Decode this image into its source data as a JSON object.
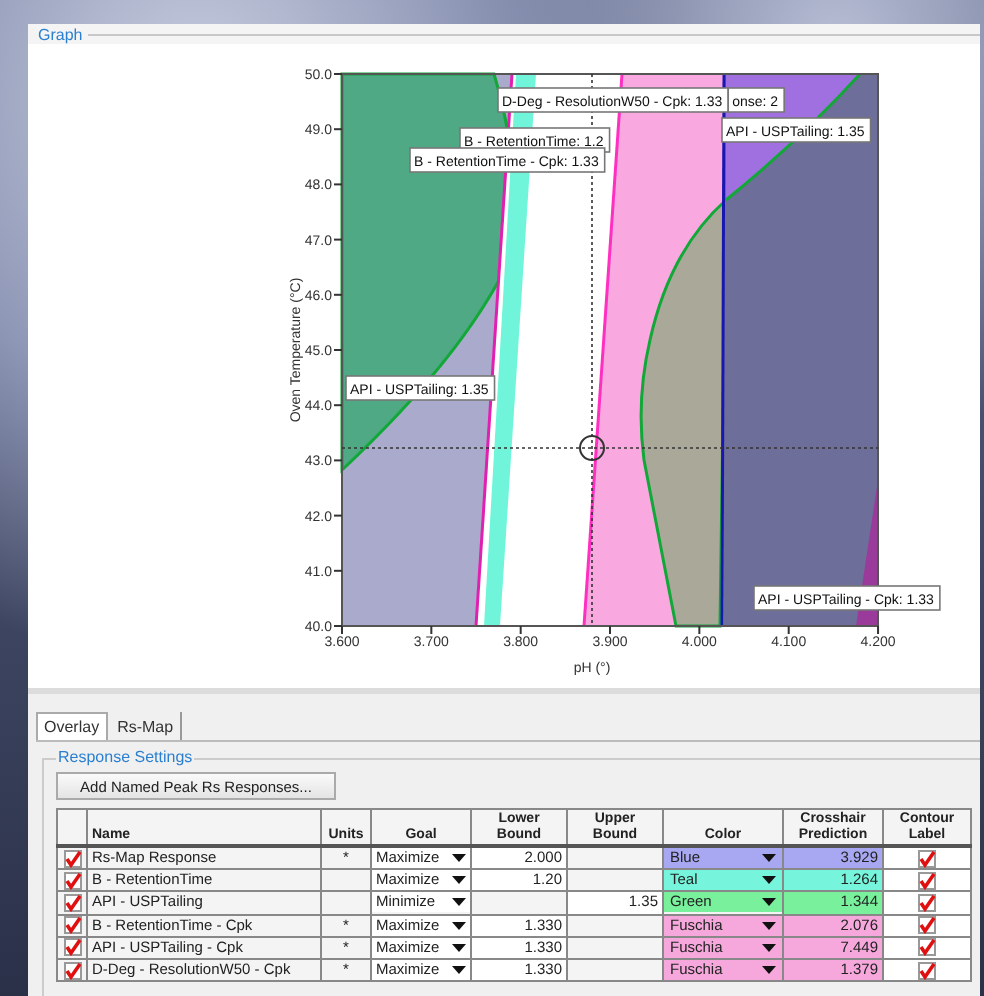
{
  "graph": {
    "title": "Graph",
    "xlabel": "pH (°)",
    "ylabel": "Oven Temperature (°C)",
    "xticks": [
      "3.600",
      "3.700",
      "3.800",
      "3.900",
      "4.000",
      "4.100",
      "4.200"
    ],
    "yticks": [
      "50.0",
      "49.0",
      "48.0",
      "47.0",
      "46.0",
      "45.0",
      "44.0",
      "43.0",
      "42.0",
      "41.0",
      "40.0"
    ],
    "contour_labels": [
      "D-Deg - ResolutionW50 - Cpk: 1.33",
      "onse: 2",
      "API - USPTailing: 1.35",
      "B - RetentionTime: 1.2",
      "B - RetentionTime - Cpk: 1.33",
      "API - USPTailing: 1.35",
      "API - USPTailing - Cpk: 1.33"
    ]
  },
  "tabs": [
    {
      "label": "Overlay",
      "selected": true
    },
    {
      "label": "Rs-Map",
      "selected": false
    }
  ],
  "response_settings": {
    "title": "Response Settings",
    "button": "Add Named Peak Rs Responses...",
    "columns": [
      "Name",
      "Units",
      "Goal",
      "Lower Bound",
      "Upper Bound",
      "Color",
      "Crosshair Prediction",
      "Contour Label"
    ],
    "rows": [
      {
        "checked": true,
        "name": "Rs-Map Response",
        "units": "*",
        "goal": "Maximize",
        "lower": "2.000",
        "color_name": "Blue",
        "color": "#a8a8f2",
        "prediction": "3.929",
        "contour_label": true
      },
      {
        "checked": true,
        "name": "B - RetentionTime",
        "goal": "Maximize",
        "lower": "1.20",
        "color_name": "Teal",
        "color": "#76f4dc",
        "prediction": "1.264",
        "contour_label": true
      },
      {
        "checked": true,
        "name": "API - USPTailing",
        "goal": "Minimize",
        "upper": "1.35",
        "color_name": "Green",
        "color": "#78f09c",
        "prediction": "1.344",
        "contour_label": true
      },
      {
        "checked": true,
        "name": "B - RetentionTime - Cpk",
        "units": "*",
        "goal": "Maximize",
        "lower": "1.330",
        "color_name": "Fuschia",
        "color": "#f6a8dc",
        "prediction": "2.076",
        "contour_label": true
      },
      {
        "checked": true,
        "name": "API - USPTailing - Cpk",
        "units": "*",
        "goal": "Maximize",
        "lower": "1.330",
        "color_name": "Fuschia",
        "color": "#f6a8dc",
        "prediction": "7.449",
        "contour_label": true
      },
      {
        "checked": true,
        "name": "D-Deg - ResolutionW50 - Cpk",
        "units": "*",
        "goal": "Maximize",
        "lower": "1.330",
        "color_name": "Fuschia",
        "color": "#f6a8dc",
        "prediction": "1.379",
        "contour_label": true
      }
    ]
  }
}
